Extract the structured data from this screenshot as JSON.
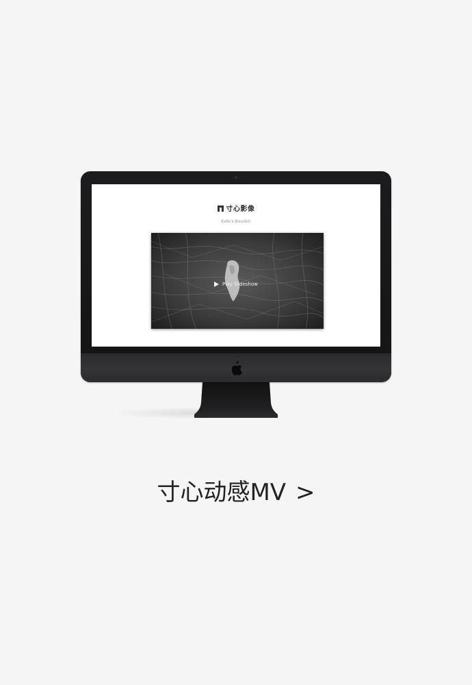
{
  "screen": {
    "brand_name": "寸心影像",
    "subtitle": "Kate's Boudoir",
    "play_label": "Play Slideshow"
  },
  "caption": {
    "title": "寸心动感MV",
    "chevron": ">"
  },
  "icons": {
    "brand": "brand-logo-icon",
    "play": "play-icon",
    "apple": "apple-logo-icon",
    "caption_link": "chevron-right-icon"
  },
  "colors": {
    "page_background": "#f5f5f5",
    "imac_bezel": "#1c1c1e",
    "screen_background": "#ffffff",
    "caption_text": "#222222"
  }
}
